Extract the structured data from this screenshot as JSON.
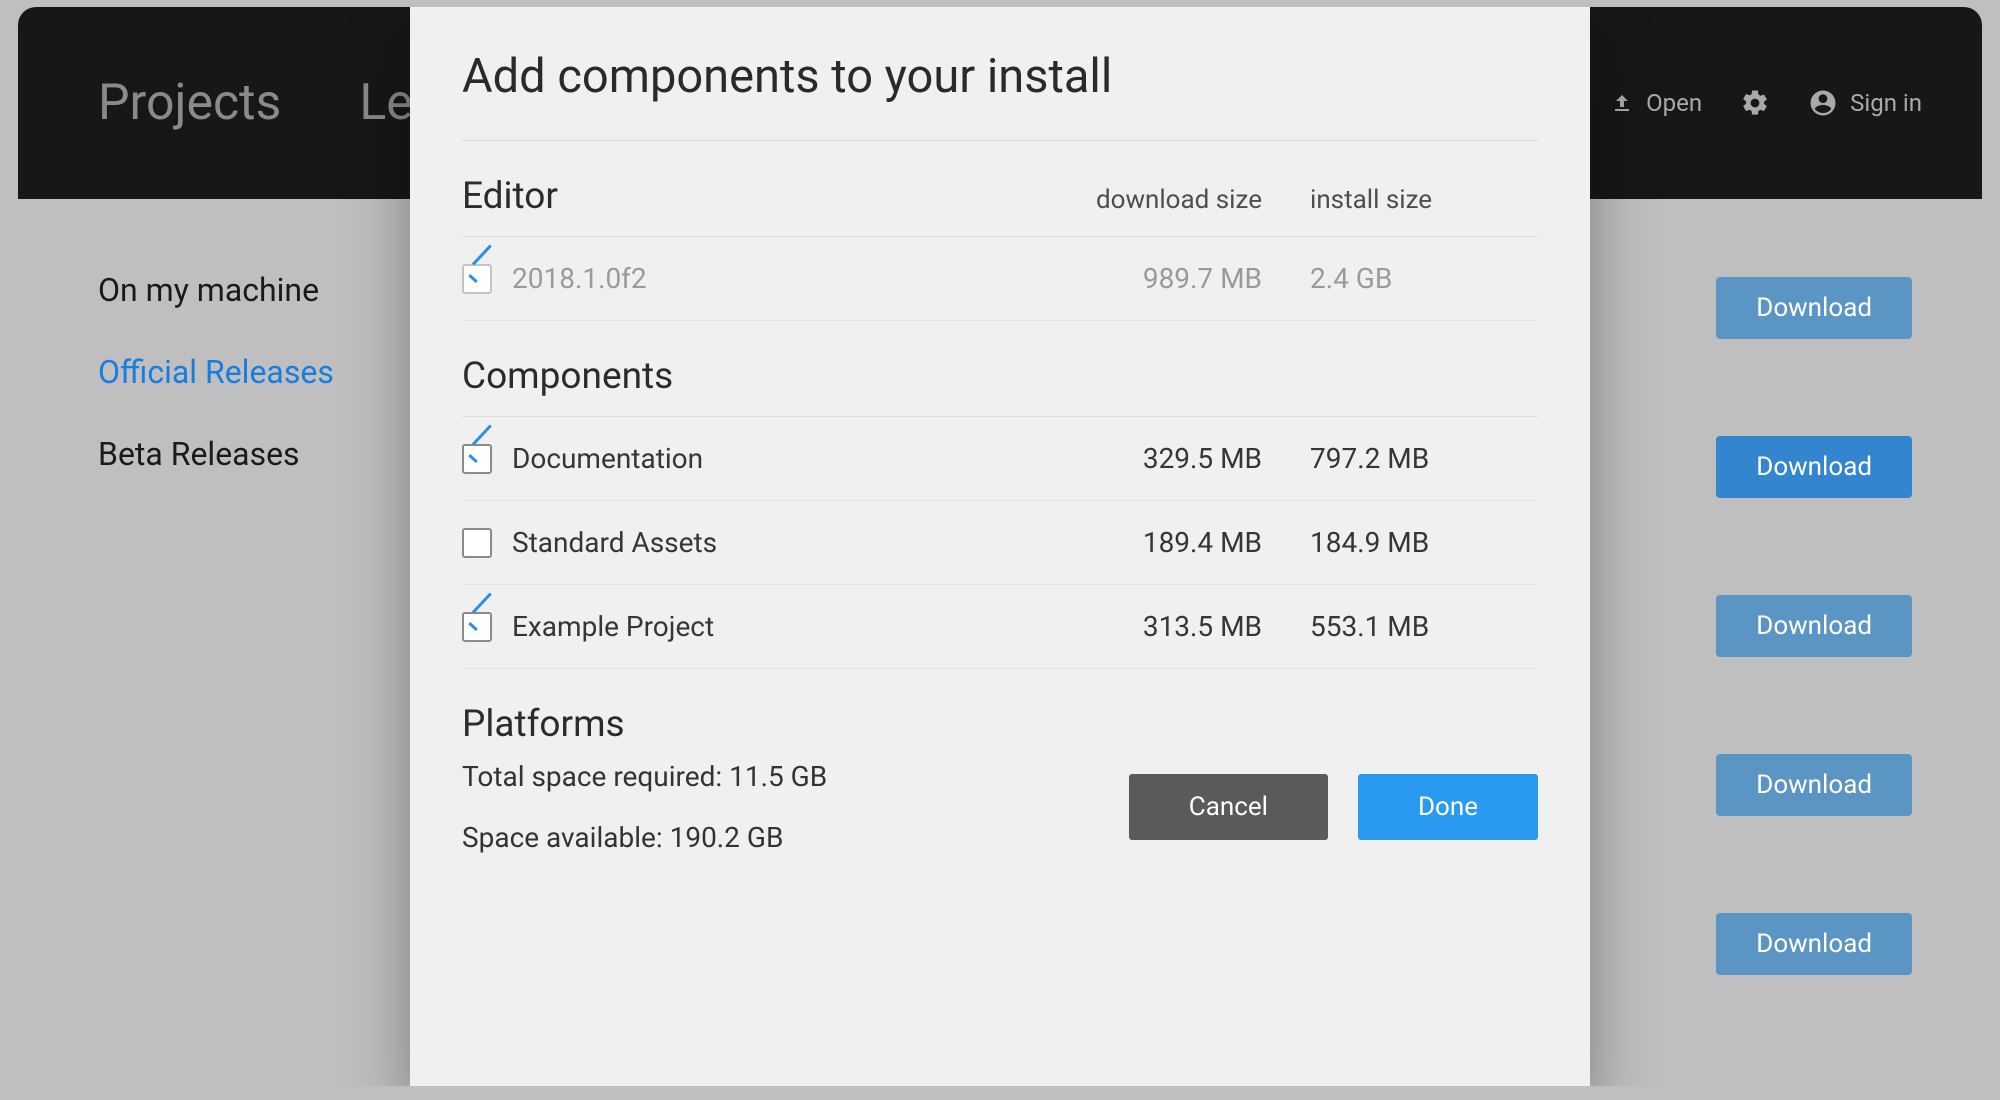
{
  "topbar": {
    "tab1": "Projects",
    "tab2": "Learn",
    "open": "Open",
    "signin": "Sign in"
  },
  "sideNav": {
    "item0": "On my machine",
    "item1": "Official Releases",
    "item2": "Beta Releases"
  },
  "download_label": "Download",
  "modal": {
    "title": "Add components to your install",
    "editor_head": "Editor",
    "download_col": "download size",
    "install_col": "install size",
    "editor": {
      "name": "2018.1.0f2",
      "download": "989.7 MB",
      "install": "2.4 GB",
      "checked": true
    },
    "components_head": "Components",
    "components": [
      {
        "name": "Documentation",
        "download": "329.5 MB",
        "install": "797.2 MB",
        "checked": true
      },
      {
        "name": "Standard Assets",
        "download": "189.4 MB",
        "install": "184.9 MB",
        "checked": false
      },
      {
        "name": "Example Project",
        "download": "313.5 MB",
        "install": "553.1 MB",
        "checked": true
      }
    ],
    "platforms_head": "Platforms",
    "total_space": "Total space required: 11.5 GB",
    "avail_space": "Space available: 190.2 GB",
    "cancel": "Cancel",
    "done": "Done"
  }
}
